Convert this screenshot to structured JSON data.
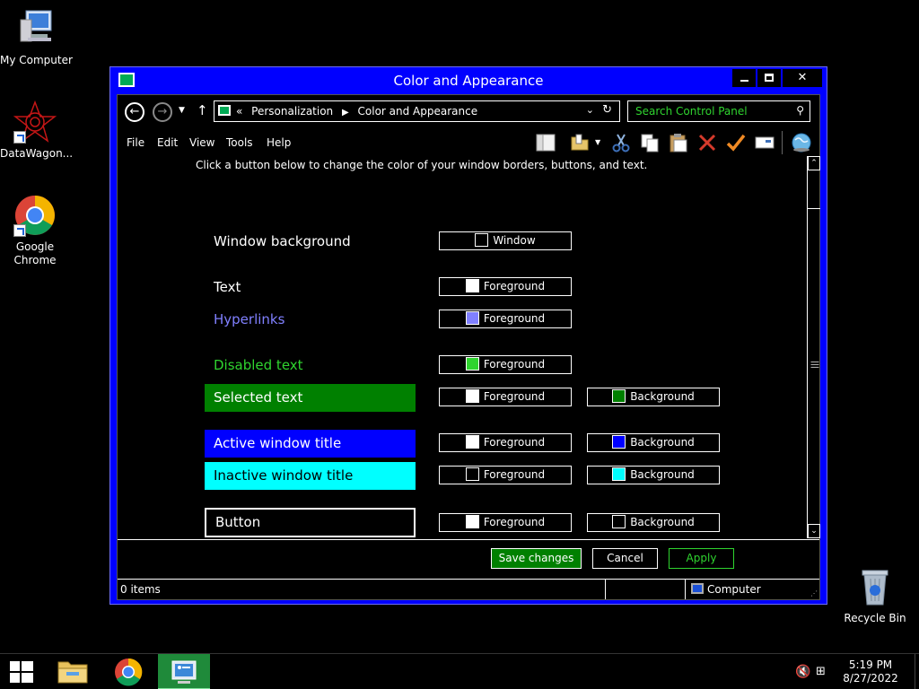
{
  "desktop": {
    "icons": [
      {
        "label": "My Computer"
      },
      {
        "label": "DataWagon..."
      },
      {
        "label": "Google Chrome"
      },
      {
        "label": "Recycle Bin"
      }
    ]
  },
  "window": {
    "title": "Color and Appearance",
    "nav": {
      "breadcrumb_prefix": "«",
      "crumbs": [
        "Personalization",
        "Color and Appearance"
      ],
      "search_placeholder": "Search Control Panel"
    },
    "menu": [
      "File",
      "Edit",
      "View",
      "Tools",
      "Help"
    ],
    "toolbar_icons": [
      "layout-icon",
      "folder-options-icon",
      "dropdown-arrow-icon",
      "cut-icon",
      "copy-icon",
      "paste-icon",
      "delete-icon",
      "properties-check-icon",
      "rename-icon",
      "globe-icon"
    ],
    "hint": "Click a button below to change the color of your window borders, buttons, and text.",
    "rows": [
      {
        "label": "Window background",
        "label_color": "#ffffff",
        "label_bg": "transparent",
        "buttons": [
          {
            "text": "Window",
            "swatch": "#000000"
          }
        ]
      },
      {
        "label": "Text",
        "label_color": "#ffffff",
        "label_bg": "transparent",
        "buttons": [
          {
            "text": "Foreground",
            "swatch": "#ffffff"
          }
        ]
      },
      {
        "label": "Hyperlinks",
        "label_color": "#8080ff",
        "label_bg": "transparent",
        "buttons": [
          {
            "text": "Foreground",
            "swatch": "#8080ff"
          }
        ]
      },
      {
        "label": "Disabled text",
        "label_color": "#2fd42f",
        "label_bg": "transparent",
        "buttons": [
          {
            "text": "Foreground",
            "swatch": "#2fd42f"
          }
        ]
      },
      {
        "label": "Selected text",
        "label_color": "#ffffff",
        "label_bg": "#008000",
        "buttons": [
          {
            "text": "Foreground",
            "swatch": "#ffffff"
          },
          {
            "text": "Background",
            "swatch": "#008000"
          }
        ]
      },
      {
        "label": "Active window title",
        "label_color": "#ffffff",
        "label_bg": "#0000ff",
        "buttons": [
          {
            "text": "Foreground",
            "swatch": "#ffffff"
          },
          {
            "text": "Background",
            "swatch": "#0000ff"
          }
        ]
      },
      {
        "label": "Inactive window title",
        "label_color": "#000000",
        "label_bg": "#00ffff",
        "buttons": [
          {
            "text": "Foreground",
            "swatch": "#000000"
          },
          {
            "text": "Background",
            "swatch": "#00ffff"
          }
        ]
      },
      {
        "label": "Button",
        "label_color": "#ffffff",
        "label_bg": "#000000",
        "buttons": [
          {
            "text": "Foreground",
            "swatch": "#ffffff"
          },
          {
            "text": "Background",
            "swatch": "#000000"
          }
        ]
      }
    ],
    "buttons": {
      "save": "Save changes",
      "cancel": "Cancel",
      "apply": "Apply"
    },
    "status": {
      "items": "0 items",
      "location": "Computer"
    }
  },
  "taskbar": {
    "apps": [
      "file-explorer-icon",
      "chrome-icon",
      "control-panel-icon"
    ],
    "time": "5:19 PM",
    "date": "8/27/2022"
  },
  "colors": {
    "window_frame": "#0000ff",
    "selected": "#008000",
    "disabled": "#2fd42f",
    "hyperlink": "#8080ff",
    "inactive_title": "#00ffff"
  }
}
